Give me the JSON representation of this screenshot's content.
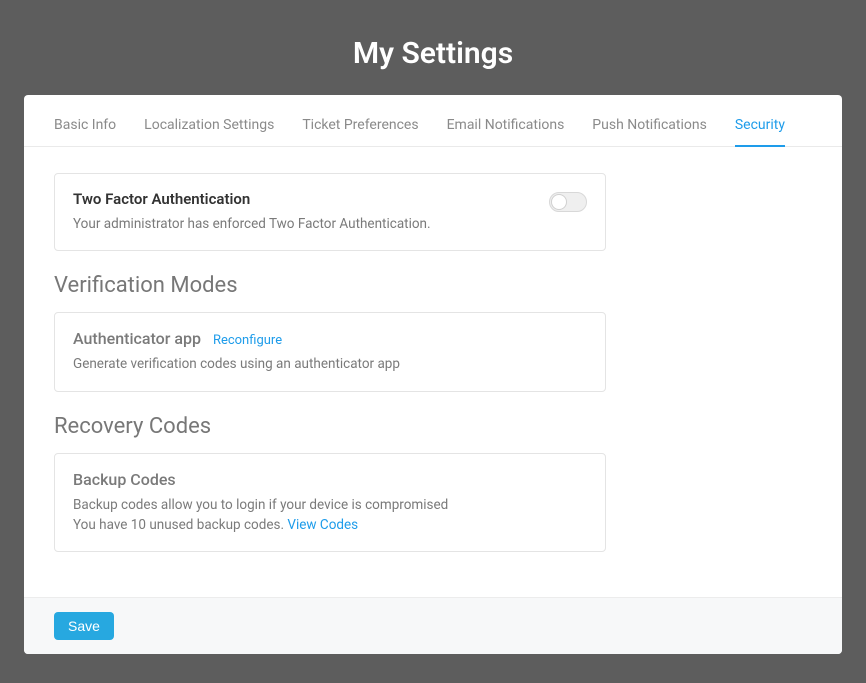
{
  "page": {
    "title": "My Settings"
  },
  "tabs": [
    {
      "label": "Basic Info",
      "active": false
    },
    {
      "label": "Localization Settings",
      "active": false
    },
    {
      "label": "Ticket Preferences",
      "active": false
    },
    {
      "label": "Email Notifications",
      "active": false
    },
    {
      "label": "Push Notifications",
      "active": false
    },
    {
      "label": "Security",
      "active": true
    }
  ],
  "tfa": {
    "title": "Two Factor Authentication",
    "desc": "Your administrator has enforced Two Factor Authentication.",
    "enabled": false
  },
  "verification": {
    "section_title": "Verification Modes",
    "authenticator": {
      "title": "Authenticator app",
      "reconfigure": "Reconfigure",
      "desc": "Generate verification codes using an authenticator app"
    }
  },
  "recovery": {
    "section_title": "Recovery Codes",
    "backup": {
      "title": "Backup Codes",
      "desc": "Backup codes allow you to login if your device is compromised",
      "status": "You have 10 unused backup codes. ",
      "view": "View Codes"
    }
  },
  "footer": {
    "save": "Save"
  }
}
